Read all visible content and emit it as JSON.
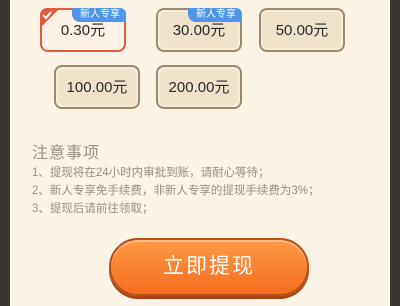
{
  "options": [
    {
      "amount": "0.30元",
      "badge": "新人专享",
      "selected": true
    },
    {
      "amount": "30.00元",
      "badge": "新人专享",
      "selected": false
    },
    {
      "amount": "50.00元",
      "badge": "",
      "selected": false
    },
    {
      "amount": "100.00元",
      "badge": "",
      "selected": false
    },
    {
      "amount": "200.00元",
      "badge": "",
      "selected": false
    }
  ],
  "notes": {
    "title": "注意事项",
    "items": [
      "1、提现将在24小时内审批到账，请耐心等待；",
      "2、新人专享免手续费，非新人专享的提现手续费为3%；",
      "3、提现后请前往领取；"
    ]
  },
  "withdraw_button": {
    "label": "立即提现"
  },
  "colors": {
    "accent_orange": "#f36d1f",
    "badge_blue": "#4f96ea",
    "selected_border": "#e05a3c"
  }
}
